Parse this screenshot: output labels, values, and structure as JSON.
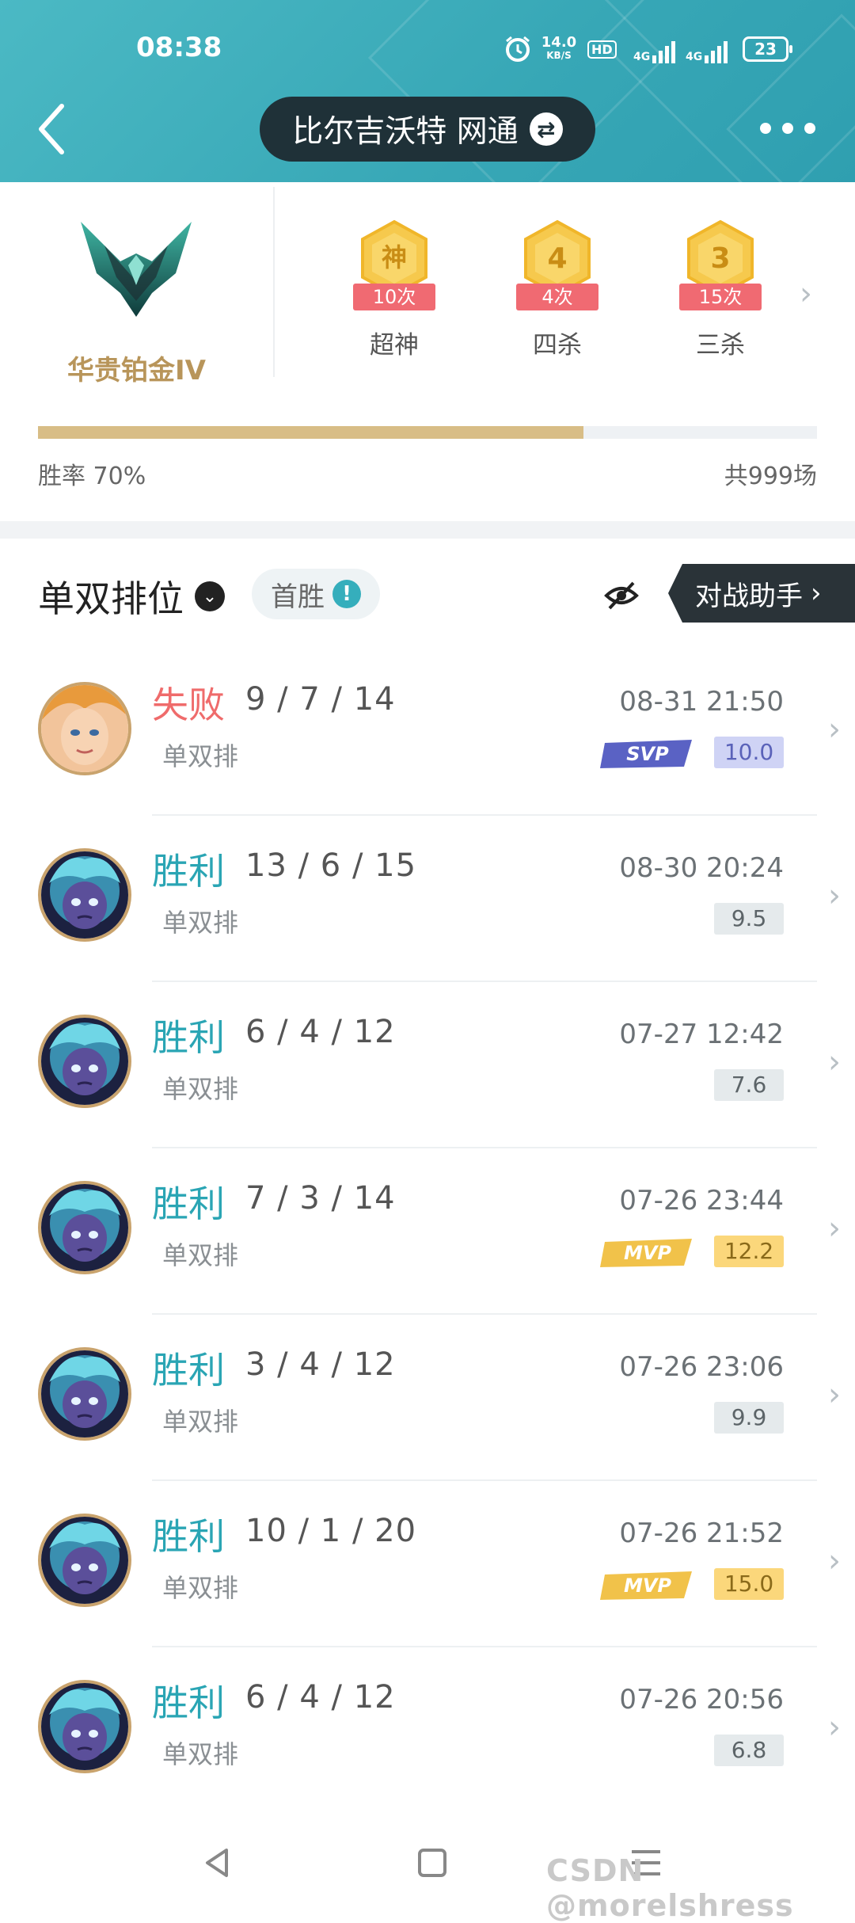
{
  "status_bar": {
    "time": "08:38",
    "speed_value": "14.0",
    "speed_unit": "KB/S",
    "hd": "HD",
    "sig1": "4G",
    "sig2": "4G",
    "battery": "23"
  },
  "header": {
    "title": "比尔吉沃特 网通",
    "swap_icon": "swap-icon",
    "more_icon": "more-icon"
  },
  "rank": {
    "name": "华贵铂金IV",
    "emblem_icon": "platinum-emblem-icon"
  },
  "badges": [
    {
      "glyph": "神",
      "count": "10次",
      "label": "超神"
    },
    {
      "glyph": "4",
      "count": "4次",
      "label": "四杀"
    },
    {
      "glyph": "3",
      "count": "15次",
      "label": "三杀"
    }
  ],
  "progress": {
    "win_rate_label": "胜率  70%",
    "win_rate_fraction": 0.7,
    "total_label": "共999场"
  },
  "filter": {
    "mode": "单双排位",
    "first_win": "首胜",
    "first_win_icon": "!",
    "assistant": "对战助手"
  },
  "colors": {
    "teal": "#37a7b6",
    "win": "#2aa5b4",
    "loss": "#ef6b6b",
    "gold": "#b8955a"
  },
  "matches": [
    {
      "result": "失败",
      "kda": "9 / 7 / 14",
      "queue": "单双排",
      "time": "08-31 21:50",
      "score": "10.0",
      "tag": "SVP"
    },
    {
      "result": "胜利",
      "kda": "13 / 6 / 15",
      "queue": "单双排",
      "time": "08-30 20:24",
      "score": "9.5",
      "tag": ""
    },
    {
      "result": "胜利",
      "kda": "6 / 4 / 12",
      "queue": "单双排",
      "time": "07-27 12:42",
      "score": "7.6",
      "tag": ""
    },
    {
      "result": "胜利",
      "kda": "7 / 3 / 14",
      "queue": "单双排",
      "time": "07-26 23:44",
      "score": "12.2",
      "tag": "MVP"
    },
    {
      "result": "胜利",
      "kda": "3 / 4 / 12",
      "queue": "单双排",
      "time": "07-26 23:06",
      "score": "9.9",
      "tag": ""
    },
    {
      "result": "胜利",
      "kda": "10 / 1 / 20",
      "queue": "单双排",
      "time": "07-26 21:52",
      "score": "15.0",
      "tag": "MVP"
    },
    {
      "result": "胜利",
      "kda": "6 / 4 / 12",
      "queue": "单双排",
      "time": "07-26 20:56",
      "score": "6.8",
      "tag": ""
    }
  ],
  "watermark": "CSDN @morelshress"
}
